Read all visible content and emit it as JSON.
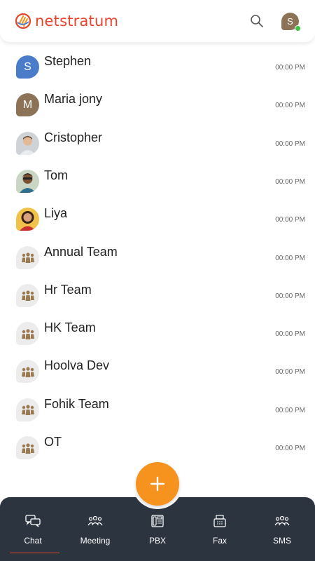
{
  "app": {
    "brand": "netstratum",
    "brand_color": "#e8452c",
    "accent_color": "#f6931f",
    "nav_bg": "#2c3440"
  },
  "header": {
    "search_icon": "search-icon",
    "user_initial": "S",
    "status": "online"
  },
  "chats": [
    {
      "name": "Stephen",
      "time": "00:00 PM",
      "avatar_type": "initial",
      "initial": "S",
      "color": "#4a7cc9"
    },
    {
      "name": "Maria jony",
      "time": "00:00 PM",
      "avatar_type": "initial",
      "initial": "M",
      "color": "#8c7357"
    },
    {
      "name": "Cristopher",
      "time": "00:00 PM",
      "avatar_type": "photo"
    },
    {
      "name": "Tom",
      "time": "00:00 PM",
      "avatar_type": "photo"
    },
    {
      "name": "Liya",
      "time": "00:00 PM",
      "avatar_type": "photo"
    },
    {
      "name": "Annual Team",
      "time": "00:00 PM",
      "avatar_type": "group"
    },
    {
      "name": "Hr Team",
      "time": "00:00 PM",
      "avatar_type": "group"
    },
    {
      "name": "HK Team",
      "time": "00:00 PM",
      "avatar_type": "group"
    },
    {
      "name": "Hoolva Dev",
      "time": "00:00 PM",
      "avatar_type": "group"
    },
    {
      "name": "Fohik Team",
      "time": "00:00 PM",
      "avatar_type": "group"
    },
    {
      "name": "OT",
      "time": "00:00 PM",
      "avatar_type": "group"
    }
  ],
  "fab": {
    "icon": "plus-icon"
  },
  "nav": [
    {
      "label": "Chat",
      "icon": "chat-icon",
      "active": true
    },
    {
      "label": "Meeting",
      "icon": "meeting-icon"
    },
    {
      "label": "PBX",
      "icon": "pbx-icon"
    },
    {
      "label": "Fax",
      "icon": "fax-icon"
    },
    {
      "label": "SMS",
      "icon": "sms-icon"
    }
  ]
}
